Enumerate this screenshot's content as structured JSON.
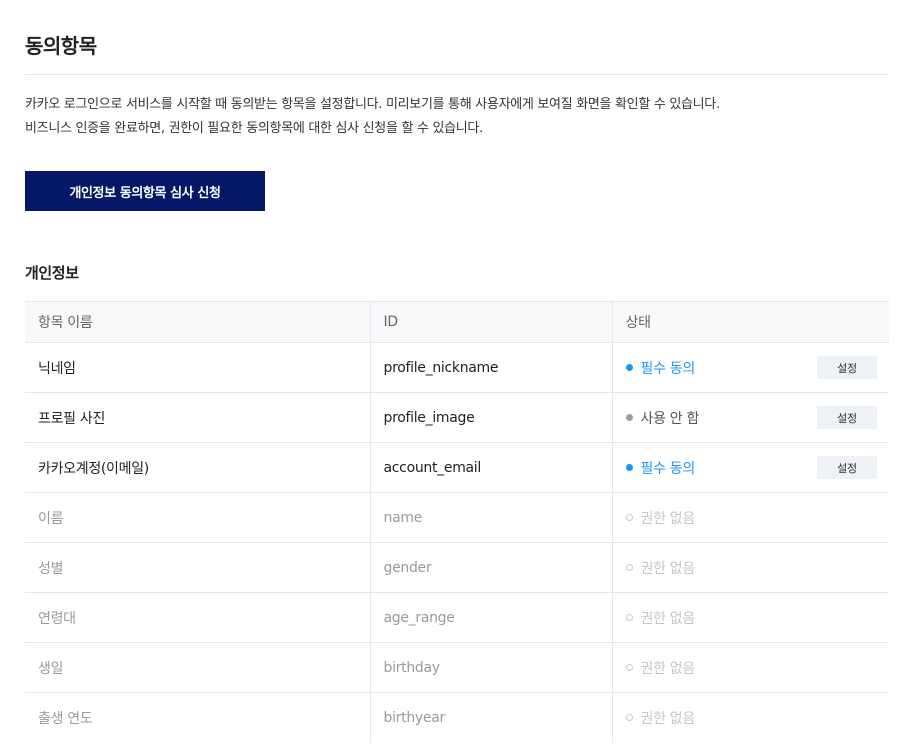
{
  "header": {
    "title": "동의항목"
  },
  "description": {
    "line1": "카카오 로그인으로 서비스를 시작할 때 동의받는 항목을 설정합니다. 미리보기를 통해 사용자에게 보여질 화면을 확인할 수 있습니다.",
    "line2": "비즈니스 인증을 완료하면, 권한이 필요한 동의항목에 대한 심사 신청을 할 수 있습니다."
  },
  "review_button": {
    "label": "개인정보 동의항목 심사 신청"
  },
  "section": {
    "title": "개인정보"
  },
  "table": {
    "columns": {
      "name": "항목 이름",
      "id": "ID",
      "status": "상태"
    },
    "rows": [
      {
        "name": "닉네임",
        "id": "profile_nickname",
        "status": "필수 동의",
        "status_type": "required",
        "action": "설정"
      },
      {
        "name": "프로필 사진",
        "id": "profile_image",
        "status": "사용 안 함",
        "status_type": "unused",
        "action": "설정"
      },
      {
        "name": "카카오계정(이메일)",
        "id": "account_email",
        "status": "필수 동의",
        "status_type": "required",
        "action": "설정"
      },
      {
        "name": "이름",
        "id": "name",
        "status": "권한 없음",
        "status_type": "none"
      },
      {
        "name": "성별",
        "id": "gender",
        "status": "권한 없음",
        "status_type": "none"
      },
      {
        "name": "연령대",
        "id": "age_range",
        "status": "권한 없음",
        "status_type": "none"
      },
      {
        "name": "생일",
        "id": "birthday",
        "status": "권한 없음",
        "status_type": "none"
      },
      {
        "name": "출생 연도",
        "id": "birthyear",
        "status": "권한 없음",
        "status_type": "none"
      }
    ]
  },
  "colors": {
    "primary_button": "#051766",
    "status_required": "#1a97f5",
    "status_unused": "#9c9c9c",
    "status_none": "#c9c9c9"
  }
}
